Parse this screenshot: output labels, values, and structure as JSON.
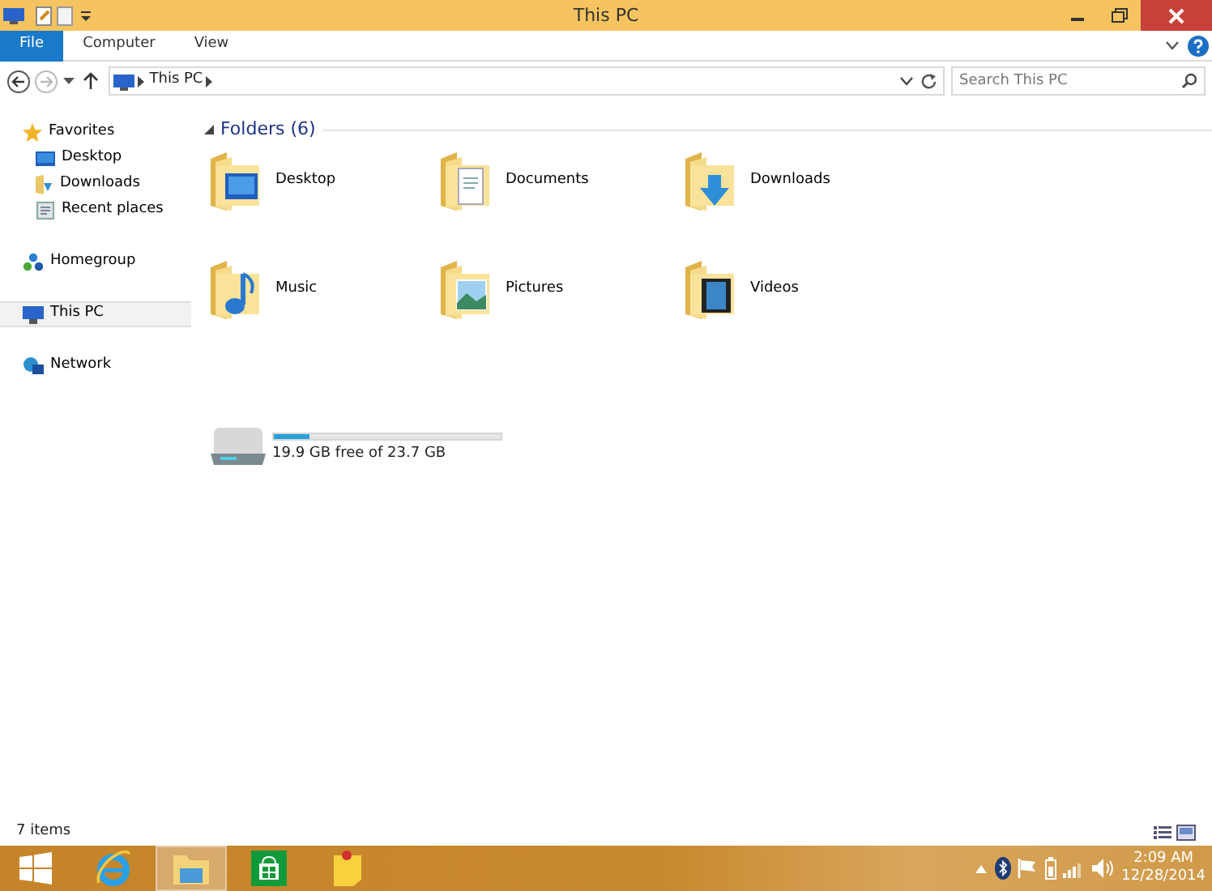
{
  "window": {
    "title": "This PC"
  },
  "ribbon": {
    "tabs": [
      {
        "label": "File",
        "kind": "file",
        "selected": false
      },
      {
        "label": "Computer",
        "kind": "tab",
        "selected": false
      },
      {
        "label": "View",
        "kind": "tab",
        "selected": false
      }
    ]
  },
  "address": {
    "path": [
      "This PC"
    ]
  },
  "search": {
    "placeholder": "Search This PC"
  },
  "sidebar": {
    "items": [
      {
        "label": "Favorites",
        "kind": "favorites",
        "selected": false,
        "children": [
          {
            "label": "Desktop",
            "kind": "desktop",
            "selected": false
          },
          {
            "label": "Downloads",
            "kind": "downloads",
            "selected": false
          },
          {
            "label": "Recent places",
            "kind": "recent",
            "selected": false
          }
        ]
      },
      {
        "label": "Homegroup",
        "kind": "homegroup",
        "selected": false
      },
      {
        "label": "This PC",
        "kind": "pc",
        "selected": true
      },
      {
        "label": "Network",
        "kind": "network",
        "selected": false
      }
    ]
  },
  "folders": {
    "heading": "Folders (6)",
    "expanded": true,
    "items": [
      {
        "label": "Desktop",
        "kind": "desktop"
      },
      {
        "label": "Documents",
        "kind": "documents"
      },
      {
        "label": "Downloads",
        "kind": "downloads"
      },
      {
        "label": "Music",
        "kind": "music"
      },
      {
        "label": "Pictures",
        "kind": "pictures"
      },
      {
        "label": "Videos",
        "kind": "videos"
      }
    ]
  },
  "drives": [
    {
      "caption": "19.9 GB free of 23.7 GB",
      "level": 0.16
    }
  ],
  "status_bar": {
    "count": "7 items"
  },
  "taskbar": {
    "apps": [
      {
        "kind": "start",
        "selected": false
      },
      {
        "kind": "ie",
        "selected": false
      },
      {
        "kind": "explorer",
        "selected": true
      },
      {
        "kind": "store",
        "selected": false
      },
      {
        "kind": "notes",
        "selected": false
      }
    ],
    "clock": {
      "time": "2:09 AM",
      "date": "12/28/2014"
    }
  }
}
